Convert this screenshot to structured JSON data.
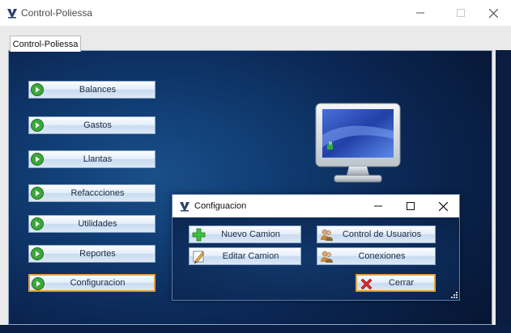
{
  "window": {
    "title": "Control-Poliessa",
    "icon": "app-logo-icon"
  },
  "tab": {
    "label": "Control-Poliessa"
  },
  "menu": {
    "items": [
      {
        "label": "Balances",
        "icon": "green-arrow-icon"
      },
      {
        "label": "Gastos",
        "icon": "green-arrow-icon"
      },
      {
        "label": "Llantas",
        "icon": "green-arrow-icon"
      },
      {
        "label": "Refaccciones",
        "icon": "green-arrow-icon"
      },
      {
        "label": "Utilidades",
        "icon": "green-arrow-icon"
      },
      {
        "label": "Reportes",
        "icon": "green-arrow-icon"
      },
      {
        "label": "Configuracion",
        "icon": "green-arrow-icon",
        "selected": true
      }
    ]
  },
  "dialog": {
    "title": "Configuacion",
    "buttons": {
      "nuevo_camion": "Nuevo Camion",
      "editar_camion": "Editar Camion",
      "control_usuarios": "Control de Usuarios",
      "conexiones": "Conexiones",
      "cerrar": "Cerrar"
    }
  },
  "colors": {
    "panel_bg": "#103c72",
    "button_border": "#8aa6c8",
    "selected_border": "#e0a33a",
    "arrow_green": "#3aa83a"
  }
}
